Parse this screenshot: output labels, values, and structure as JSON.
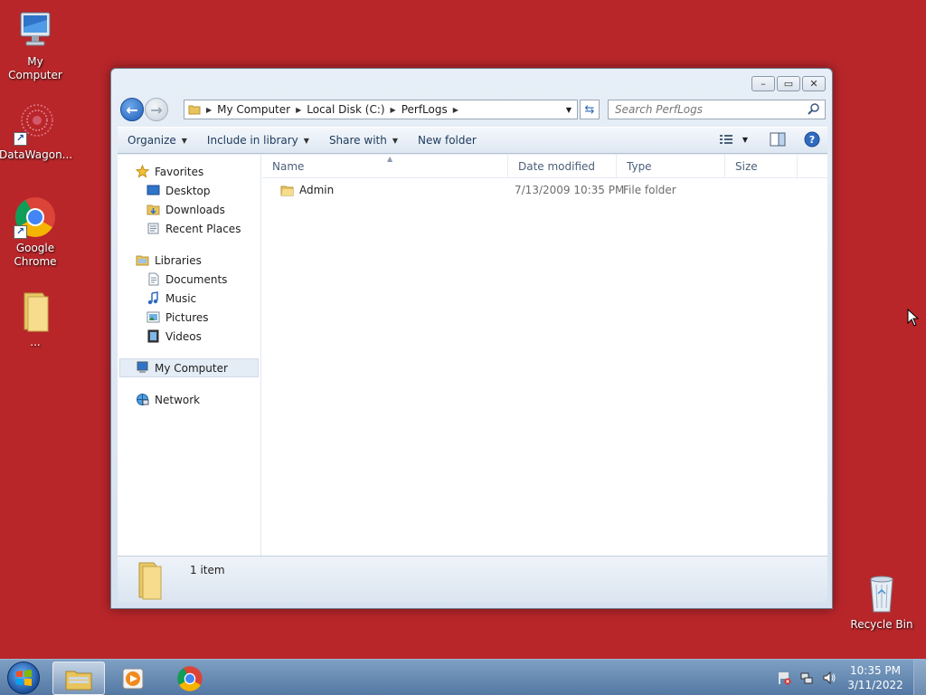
{
  "desktop": {
    "icons": [
      {
        "label": "My Computer"
      },
      {
        "label": "DataWagon..."
      },
      {
        "label": "Google Chrome"
      },
      {
        "label": "..."
      },
      {
        "label": "Recycle Bin"
      }
    ]
  },
  "window": {
    "address": {
      "crumbs": [
        "My Computer",
        "Local Disk (C:)",
        "PerfLogs"
      ]
    },
    "search": {
      "placeholder": "Search PerfLogs"
    },
    "toolbar": {
      "organize": "Organize",
      "include_in_library": "Include in library",
      "share_with": "Share with",
      "new_folder": "New folder"
    },
    "nav": {
      "favorites": {
        "label": "Favorites",
        "items": [
          "Desktop",
          "Downloads",
          "Recent Places"
        ]
      },
      "libraries": {
        "label": "Libraries",
        "items": [
          "Documents",
          "Music",
          "Pictures",
          "Videos"
        ]
      },
      "computer": "My Computer",
      "network": "Network"
    },
    "columns": [
      "Name",
      "Date modified",
      "Type",
      "Size"
    ],
    "files": [
      {
        "name": "Admin",
        "date_modified": "7/13/2009 10:35 PM",
        "type": "File folder",
        "size": ""
      }
    ],
    "status": {
      "item_count": "1 item"
    }
  },
  "taskbar": {
    "clock": {
      "time": "10:35 PM",
      "date": "3/11/2022"
    }
  },
  "colors": {
    "desktop_background": "#b8262a",
    "accent": "#1f5fb8"
  }
}
